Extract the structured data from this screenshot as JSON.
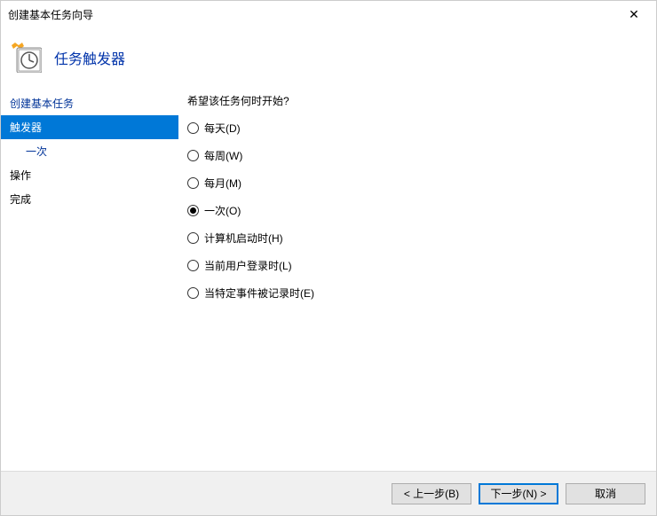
{
  "window": {
    "title": "创建基本任务向导",
    "close_glyph": "✕"
  },
  "header": {
    "title": "任务触发器"
  },
  "sidebar": {
    "items": [
      {
        "label": "创建基本任务",
        "selected": false,
        "indent": false,
        "link": true
      },
      {
        "label": "触发器",
        "selected": true,
        "indent": false,
        "link": false
      },
      {
        "label": "一次",
        "selected": false,
        "indent": true,
        "link": true
      },
      {
        "label": "操作",
        "selected": false,
        "indent": false,
        "link": false
      },
      {
        "label": "完成",
        "selected": false,
        "indent": false,
        "link": false
      }
    ]
  },
  "main": {
    "prompt": "希望该任务何时开始?",
    "options": [
      {
        "label": "每天(D)",
        "checked": false
      },
      {
        "label": "每周(W)",
        "checked": false
      },
      {
        "label": "每月(M)",
        "checked": false
      },
      {
        "label": "一次(O)",
        "checked": true
      },
      {
        "label": "计算机启动时(H)",
        "checked": false
      },
      {
        "label": "当前用户登录时(L)",
        "checked": false
      },
      {
        "label": "当特定事件被记录时(E)",
        "checked": false
      }
    ]
  },
  "footer": {
    "back": "< 上一步(B)",
    "next": "下一步(N) >",
    "cancel": "取消"
  }
}
